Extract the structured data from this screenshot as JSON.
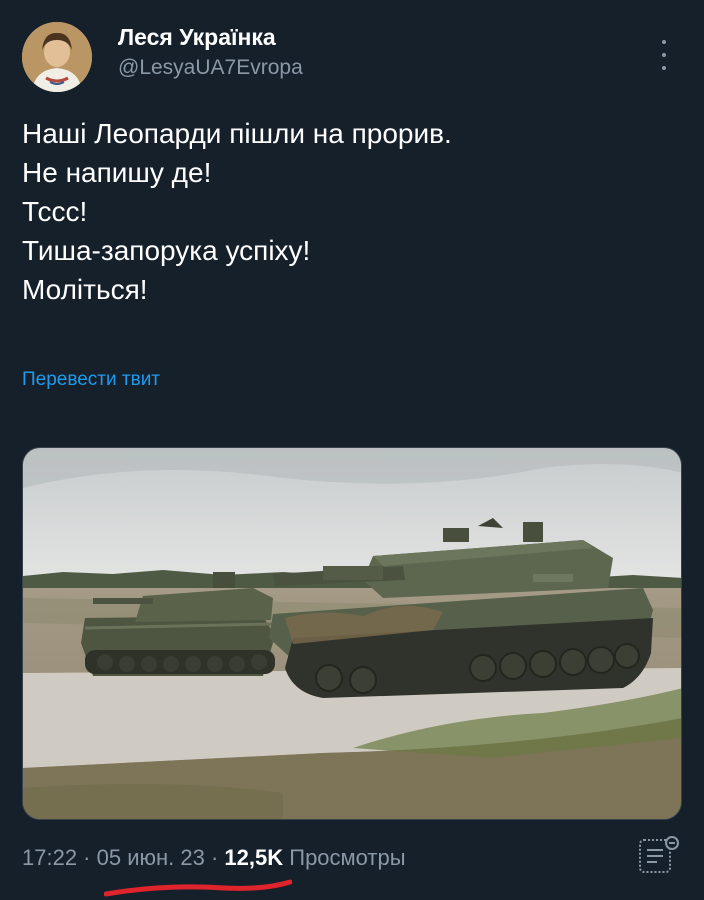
{
  "user": {
    "display_name": "Леся Українка",
    "handle": "@LesyaUA7Evropa"
  },
  "tweet": {
    "lines": [
      "Наші Леопарди пішли на прорив.",
      "Не напишу де!",
      "Тссс!",
      "Тиша-запорука успіху!",
      "Моліться!"
    ],
    "translate_label": "Перевести твит"
  },
  "meta": {
    "time": "17:22",
    "separator": " · ",
    "date": "05 июн. 23",
    "views_count": "12,5K",
    "views_label": "Просмотры"
  },
  "icons": {
    "more": "more-vertical-icon",
    "analytics": "analytics-icon"
  },
  "colors": {
    "background": "#15202b",
    "link": "#1d9bf0",
    "secondary_text": "#8b98a5",
    "annotation": "#e0242b"
  }
}
